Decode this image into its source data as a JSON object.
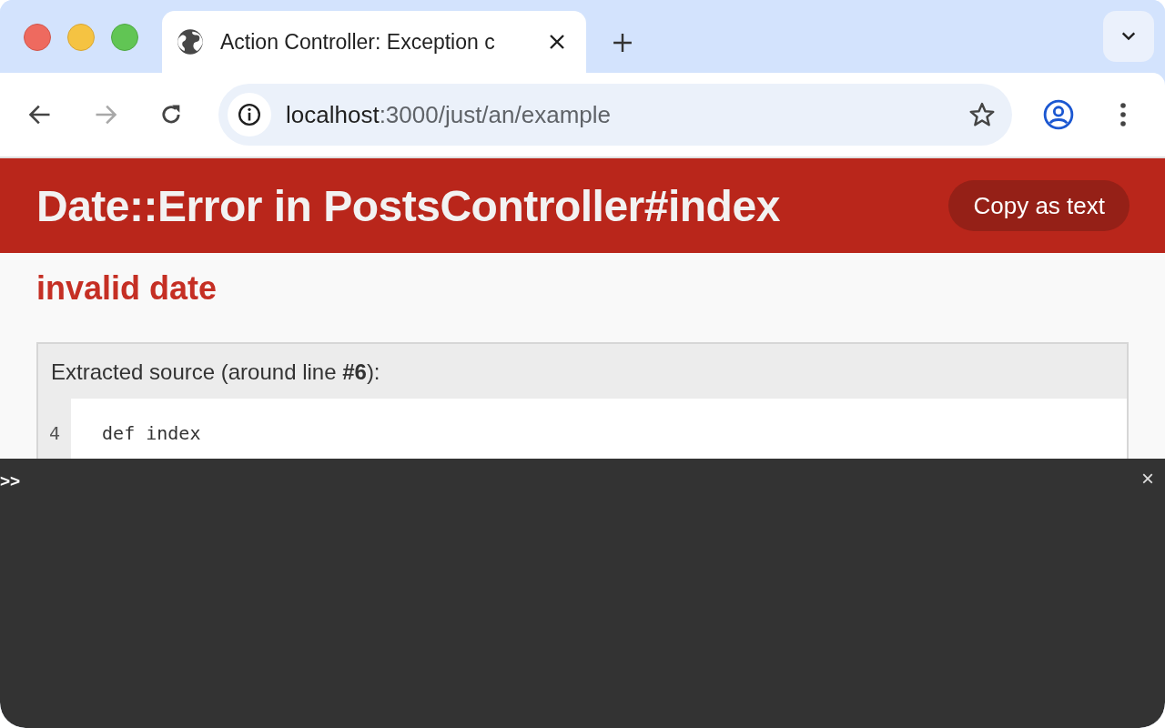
{
  "tabs": [
    {
      "title": "Action Controller: Exception c",
      "selected": true
    }
  ],
  "address": {
    "host": "localhost",
    "path": ":3000/just/an/example"
  },
  "page": {
    "title": "Date::Error in PostsController#index",
    "copy_button": "Copy as text",
    "message": "invalid date",
    "source": {
      "caption": "Extracted source (around line **#6**):",
      "lines": [
        {
          "number": "4",
          "code": "  def index"
        }
      ]
    }
  },
  "console": {
    "prompt": ">>",
    "close": "×"
  }
}
